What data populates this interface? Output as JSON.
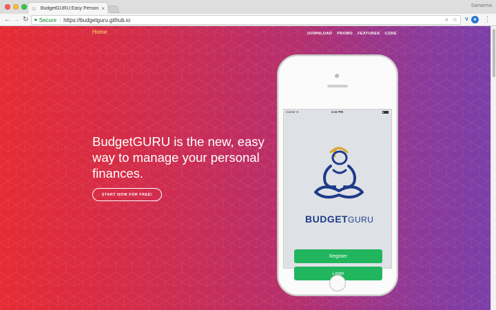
{
  "browser": {
    "tab_title": "BudgetGURU:Easy Personal Fi",
    "tab_close": "×",
    "profile_name": "Samarma",
    "secure_label": "Secure",
    "url": "https://budgetguru.github.io"
  },
  "site": {
    "home_link": "Home",
    "nav": [
      "DOWNLOAD",
      "PROMO",
      "FEATURES",
      "CODE"
    ],
    "headline": "BudgetGURU is the new, easy way to manage your personal finances.",
    "cta": "START NOW FOR FREE!"
  },
  "phone": {
    "carrier": "Carrier ≋",
    "time": "4:22 PM",
    "brand_budget": "BUDGET",
    "brand_guru": "GURU",
    "register": "Register",
    "login": "Login"
  },
  "colors": {
    "gradient_start": "#e62b33",
    "gradient_end": "#7b3ea8",
    "home_link": "#fde26a",
    "button_green": "#21b55e",
    "brand_blue": "#1e3a8a",
    "halo_gold": "#d7a52b"
  },
  "icons": [
    "back-icon",
    "forward-icon",
    "reload-icon",
    "lock-icon",
    "search-icon",
    "star-icon",
    "menu-icon"
  ]
}
